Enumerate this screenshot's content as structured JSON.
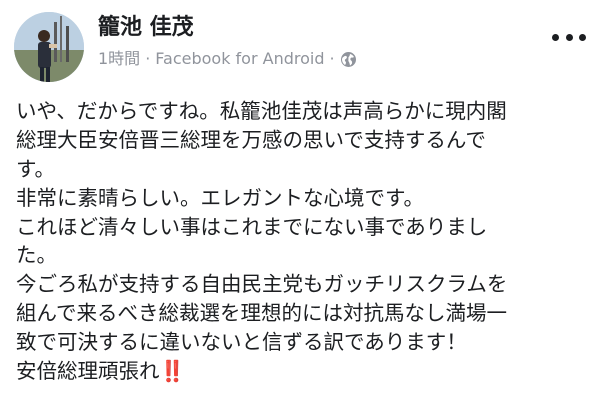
{
  "post": {
    "author_name": "籠池 佳茂",
    "time": "1時間",
    "separator": "·",
    "source": "Facebook for Android",
    "privacy_icon": "globe-icon",
    "more_icon": "more-options-icon",
    "lines": [
      "いや、だからですね。私籠池佳茂は声高らかに現内閣",
      "総理大臣安倍晋三総理を万感の思いで支持するんで",
      "す。",
      "非常に素晴らしい。エレガントな心境です。",
      "これほど清々しい事はこれまでにない事でありまし",
      "た。",
      "今ごろ私が支持する自由民主党もガッチリスクラムを",
      "組んで来るべき総裁選を理想的には対抗馬なし満場一",
      "致で可決するに違いないと信ずる訳であります！",
      "安倍総理頑張れ"
    ],
    "last_line_emoji": "‼️",
    "colors": {
      "text": "#1c1e21",
      "meta": "#90949c",
      "emoji": "#e0303a"
    }
  }
}
